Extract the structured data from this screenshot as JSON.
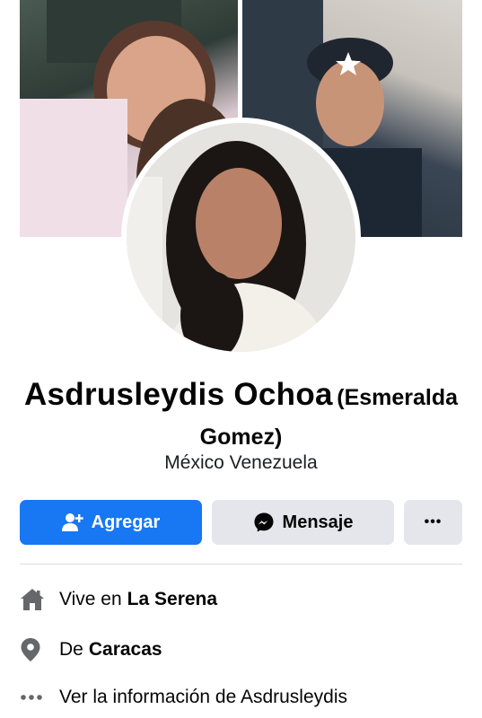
{
  "profile": {
    "name": "Asdrusleydis Ochoa",
    "alternate_name": "(Esmeralda Gomez)",
    "location": "México Venezuela"
  },
  "actions": {
    "add_label": "Agregar",
    "message_label": "Mensaje",
    "more_label": "•••"
  },
  "intro": {
    "lives_prefix": "Vive en",
    "lives_place": "La Serena",
    "from_prefix": "De",
    "from_place": "Caracas",
    "see_about": "Ver la información de Asdrusleydis"
  },
  "icons": {
    "cover_left": "cover-photo-left",
    "cover_right": "cover-photo-right",
    "avatar": "profile-photo",
    "add": "add-friend-icon",
    "message": "messenger-icon",
    "more": "more-icon",
    "home": "home-icon",
    "pin": "location-pin-icon",
    "dots": "more-dots-icon"
  },
  "colors": {
    "primary": "#1877f2",
    "secondary_button": "#e4e6eb",
    "icon_gray": "#65676b"
  }
}
